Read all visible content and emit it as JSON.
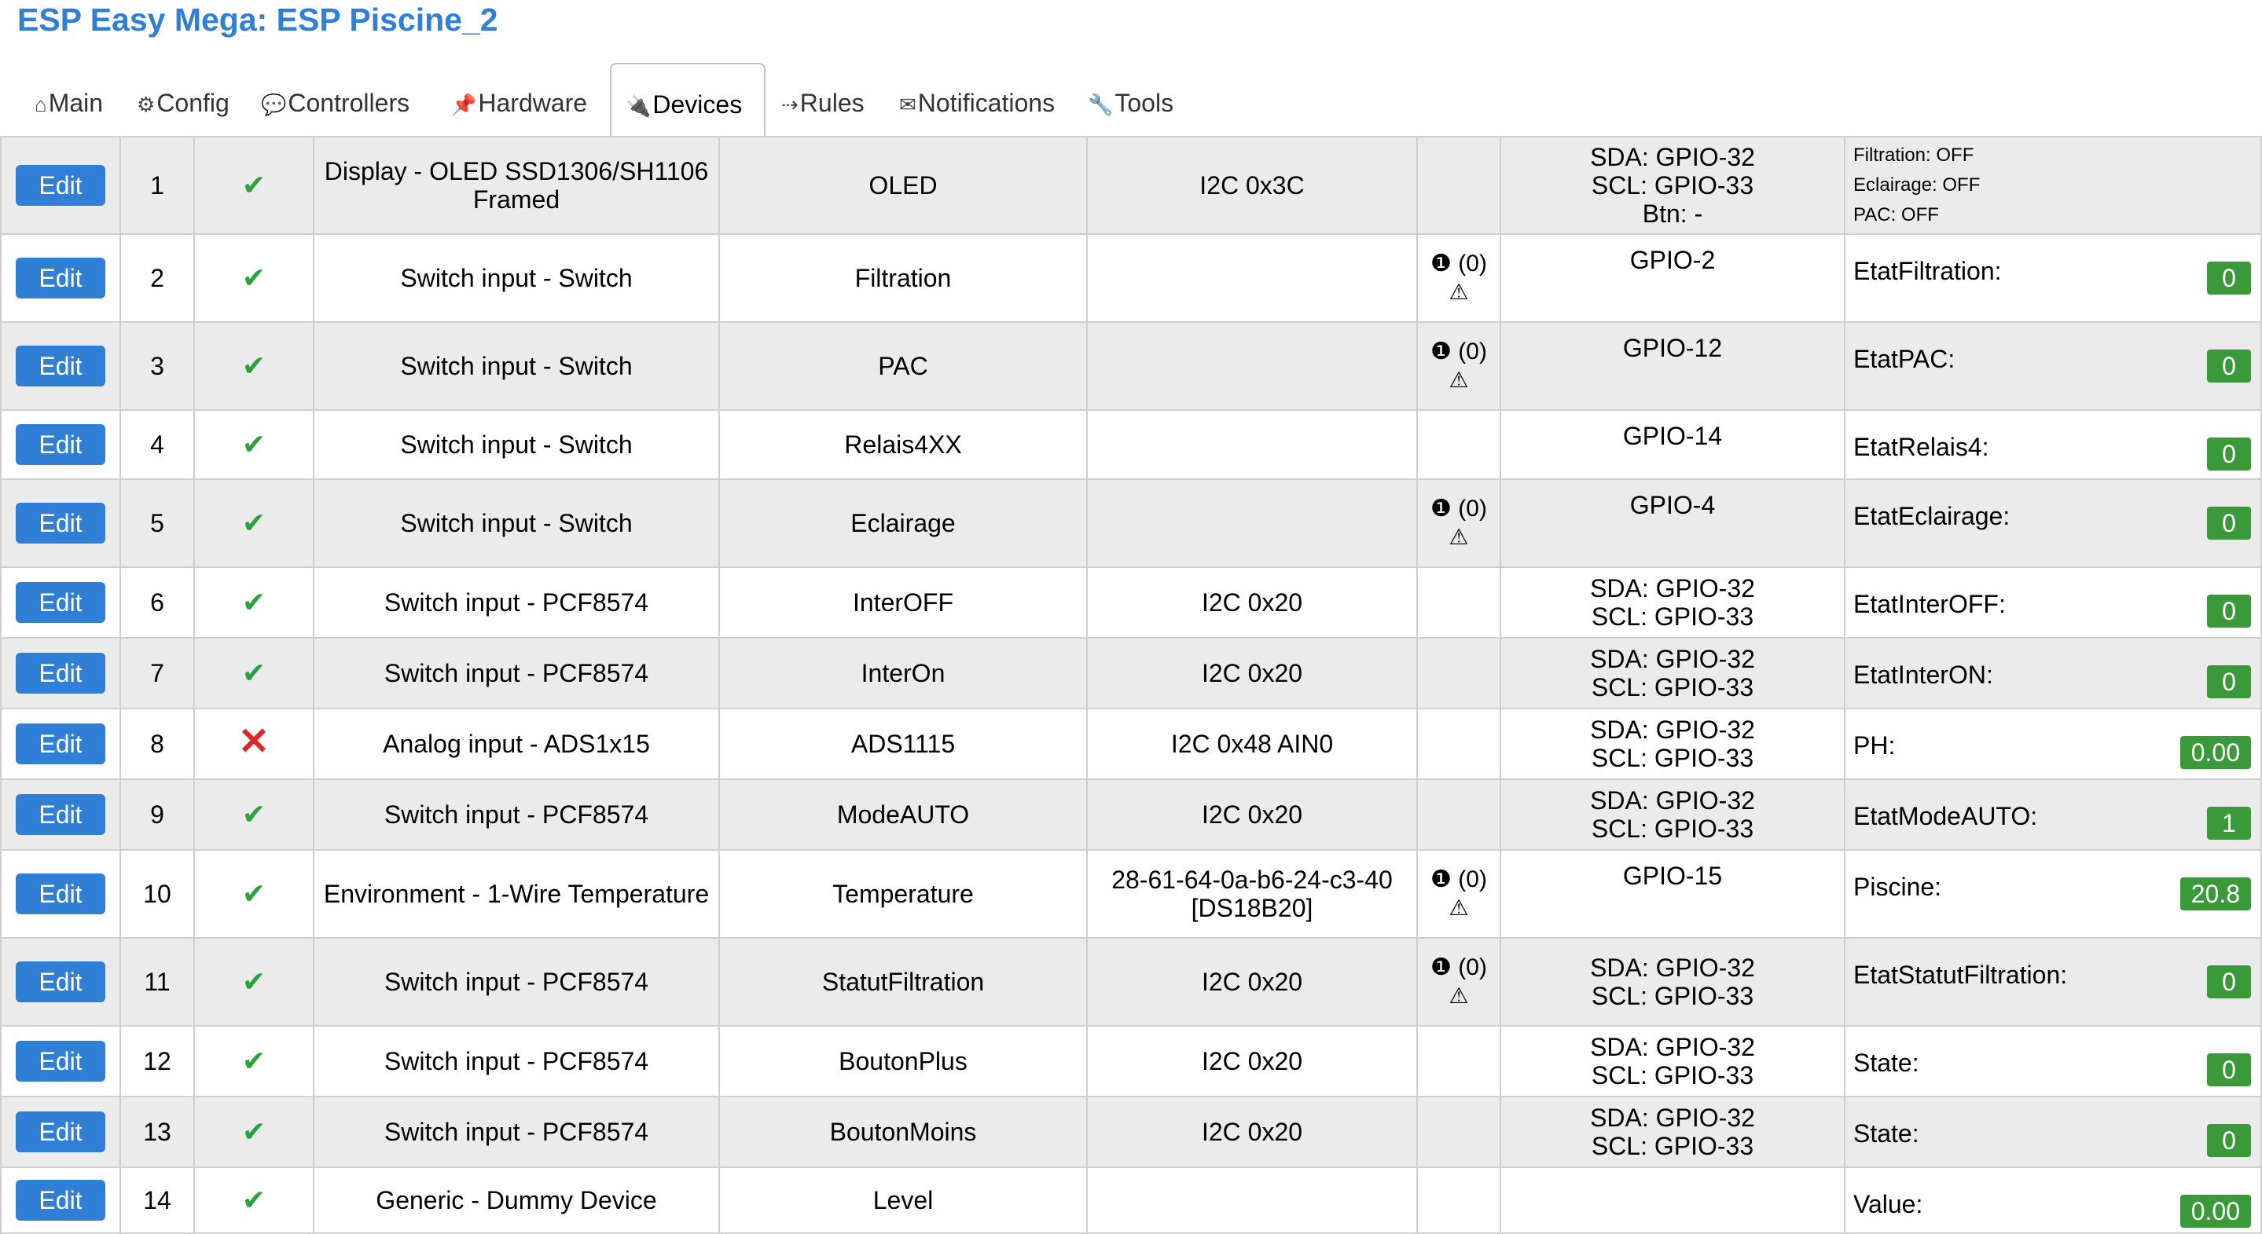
{
  "title": "ESP Easy Mega: ESP Piscine_2",
  "tabs": [
    {
      "icon": "⌂",
      "label": "Main"
    },
    {
      "icon": "⚙",
      "label": "Config"
    },
    {
      "icon": "💬",
      "label": "Controllers"
    },
    {
      "icon": "📌",
      "label": "Hardware"
    },
    {
      "icon": "🔌",
      "label": "Devices"
    },
    {
      "icon": "⇢",
      "label": "Rules"
    },
    {
      "icon": "✉",
      "label": "Notifications"
    },
    {
      "icon": "🔧",
      "label": "Tools"
    }
  ],
  "edit_label": "Edit",
  "tip_text": "(0)",
  "rows": [
    {
      "num": "1",
      "enabled": true,
      "device": "Display - OLED SSD1306/SH1106 Framed",
      "name": "OLED",
      "port": "I2C 0x3C",
      "gpio": [
        "SDA: GPIO-32",
        "SCL: GPIO-33",
        "Btn: -"
      ],
      "values": [
        "Filtration: OFF",
        "Eclairage: OFF",
        "PAC: OFF"
      ]
    },
    {
      "num": "2",
      "enabled": true,
      "device": "Switch input - Switch",
      "name": "Filtration",
      "port": "",
      "tip": true,
      "gpio": [
        "GPIO-2"
      ],
      "vname": "EtatFiltration:",
      "value": "0"
    },
    {
      "num": "3",
      "enabled": true,
      "device": "Switch input - Switch",
      "name": "PAC",
      "port": "",
      "tip": true,
      "gpio": [
        "GPIO-12"
      ],
      "vname": "EtatPAC:",
      "value": "0"
    },
    {
      "num": "4",
      "enabled": true,
      "device": "Switch input - Switch",
      "name": "Relais4XX",
      "port": "",
      "gpio": [
        "GPIO-14"
      ],
      "vname": "EtatRelais4:",
      "value": "0"
    },
    {
      "num": "5",
      "enabled": true,
      "device": "Switch input - Switch",
      "name": "Eclairage",
      "port": "",
      "tip": true,
      "gpio": [
        "GPIO-4"
      ],
      "vname": "EtatEclairage:",
      "value": "0"
    },
    {
      "num": "6",
      "enabled": true,
      "device": "Switch input - PCF8574",
      "name": "InterOFF",
      "port": "I2C 0x20",
      "gpio": [
        "SDA: GPIO-32",
        "SCL: GPIO-33"
      ],
      "vname": "EtatInterOFF:",
      "value": "0"
    },
    {
      "num": "7",
      "enabled": true,
      "device": "Switch input - PCF8574",
      "name": "InterOn",
      "port": "I2C 0x20",
      "gpio": [
        "SDA: GPIO-32",
        "SCL: GPIO-33"
      ],
      "vname": "EtatInterON:",
      "value": "0"
    },
    {
      "num": "8",
      "enabled": false,
      "device": "Analog input - ADS1x15",
      "name": "ADS1115",
      "port": "I2C 0x48 AIN0",
      "gpio": [
        "SDA: GPIO-32",
        "SCL: GPIO-33"
      ],
      "vname": "PH:",
      "value": "0.00"
    },
    {
      "num": "9",
      "enabled": true,
      "device": "Switch input - PCF8574",
      "name": "ModeAUTO",
      "port": "I2C 0x20",
      "gpio": [
        "SDA: GPIO-32",
        "SCL: GPIO-33"
      ],
      "vname": "EtatModeAUTO:",
      "value": "1"
    },
    {
      "num": "10",
      "enabled": true,
      "device": "Environment - 1-Wire Temperature",
      "name": "Temperature",
      "port": "28-61-64-0a-b6-24-c3-40 [DS18B20]",
      "tip": true,
      "gpio": [
        "GPIO-15"
      ],
      "vname": "Piscine:",
      "value": "20.8"
    },
    {
      "num": "11",
      "enabled": true,
      "device": "Switch input - PCF8574",
      "name": "StatutFiltration",
      "port": "I2C 0x20",
      "tip": true,
      "gpio": [
        "SDA: GPIO-32",
        "SCL: GPIO-33"
      ],
      "vname": "EtatStatutFiltration:",
      "value": "0"
    },
    {
      "num": "12",
      "enabled": true,
      "device": "Switch input - PCF8574",
      "name": "BoutonPlus",
      "port": "I2C 0x20",
      "gpio": [
        "SDA: GPIO-32",
        "SCL: GPIO-33"
      ],
      "vname": "State:",
      "value": "0"
    },
    {
      "num": "13",
      "enabled": true,
      "device": "Switch input - PCF8574",
      "name": "BoutonMoins",
      "port": "I2C 0x20",
      "gpio": [
        "SDA: GPIO-32",
        "SCL: GPIO-33"
      ],
      "vname": "State:",
      "value": "0"
    },
    {
      "num": "14",
      "enabled": true,
      "device": "Generic - Dummy Device",
      "name": "Level",
      "port": "",
      "gpio": [],
      "vname": "Value:",
      "value": "0.00"
    }
  ]
}
